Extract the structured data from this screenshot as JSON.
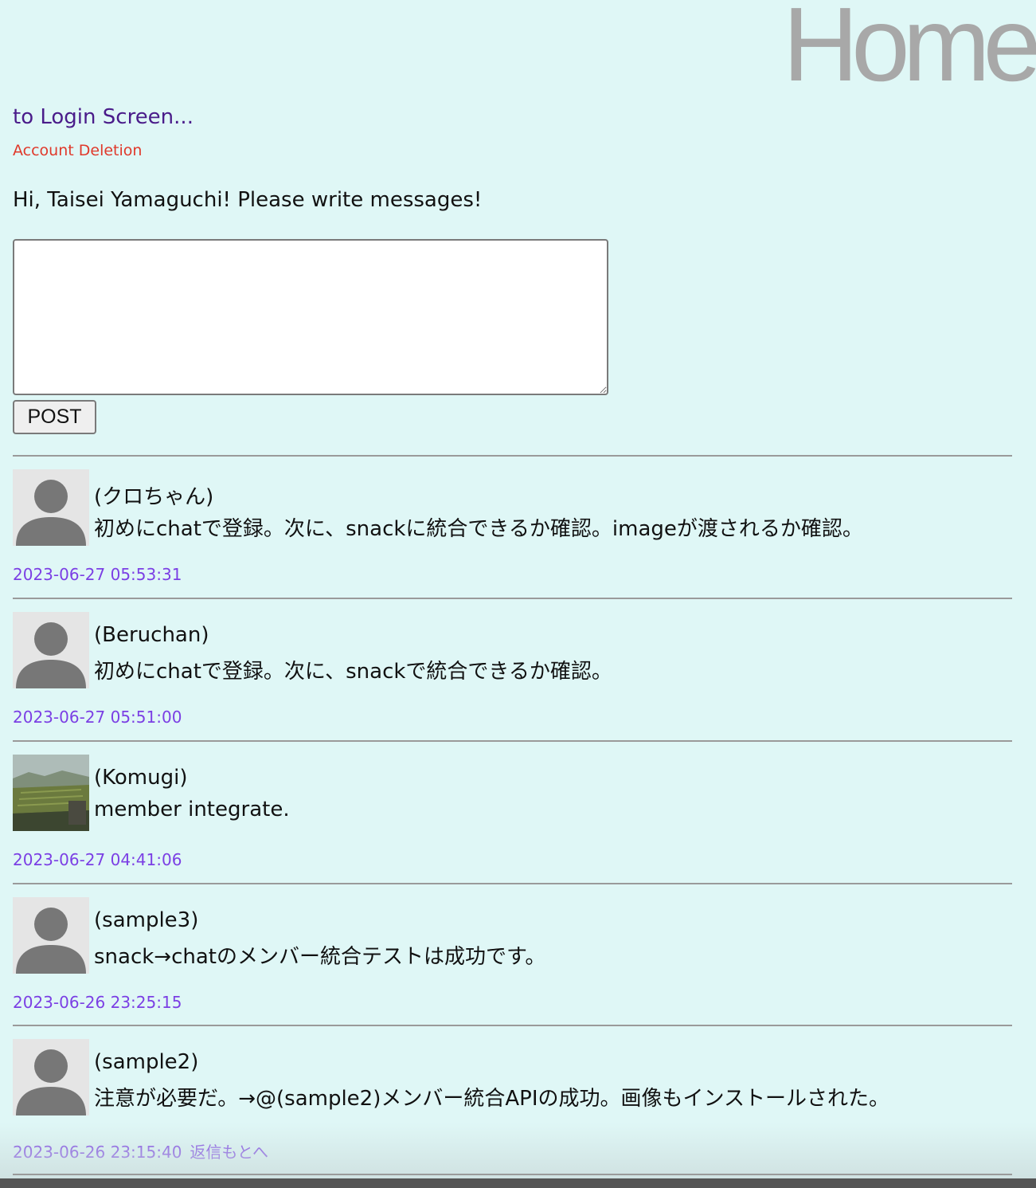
{
  "header": {
    "title": "Home",
    "login_link": "to Login Screen...",
    "account_deletion_link": "Account Deletion"
  },
  "greeting": "Hi, Taisei Yamaguchi! Please write messages!",
  "composer": {
    "message_value": "",
    "post_label": "POST"
  },
  "posts": [
    {
      "author": "(クロちゃん)",
      "body": "初めにchatで登録。次に、snackに統合できるか確認。imageが渡されるか確認。",
      "timestamp": "2023-06-27 05:53:31",
      "avatar": "default-avatar-icon"
    },
    {
      "author": "(Beruchan)",
      "body": "初めにchatで登録。次に、snackで統合できるか確認。",
      "timestamp": "2023-06-27 05:51:00",
      "avatar": "default-avatar-icon"
    },
    {
      "author": "(Komugi)",
      "body": "member integrate.",
      "timestamp": "2023-06-27 04:41:06",
      "avatar": "landscape-photo"
    },
    {
      "author": "(sample3)",
      "body": "snack→chatのメンバー統合テストは成功です。",
      "timestamp": "2023-06-26 23:25:15",
      "avatar": "default-avatar-icon"
    },
    {
      "author": "(sample2)",
      "body": "注意が必要だ。→@(sample2)メンバー統合APIの成功。画像もインストールされた。",
      "timestamp": "2023-06-26 23:15:40",
      "reply_link": "返信もとへ",
      "avatar": "default-avatar-icon"
    }
  ],
  "colors": {
    "background": "#dff7f6",
    "title": "#a8a8a8",
    "login_link": "#4a1c8a",
    "delete_link": "#e0392b",
    "timestamp": "#7b3fe4"
  }
}
